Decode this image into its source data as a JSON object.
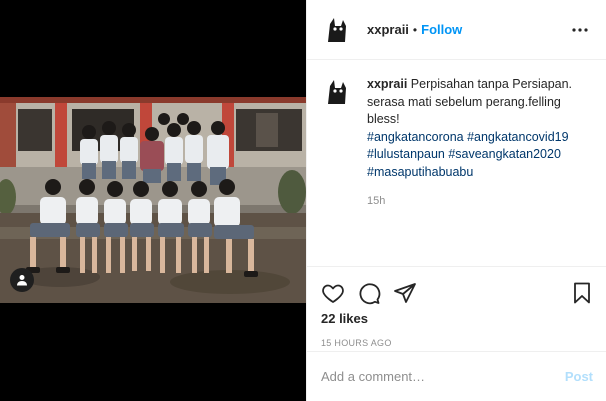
{
  "post": {
    "username": "xxpraii",
    "separator": "•",
    "follow_label": "Follow",
    "more_icon": "more-options-icon",
    "caption": {
      "text": "Perpisahan tanpa Persiapan. serasa mati sebelum perang.felling bless!",
      "hashtags": [
        "#angkatancorona #angkatancovid19",
        "#lulustanpaun #saveangkatan2020",
        "#masaputihabuabu"
      ],
      "time": "15h"
    },
    "likes": "22 likes",
    "timestamp": "15 HOURS AGO",
    "comment_placeholder": "Add a comment…",
    "post_label": "Post",
    "colors": {
      "follow": "#0095f6",
      "hashtag": "#00376b",
      "post_disabled": "#b2dffc"
    }
  }
}
